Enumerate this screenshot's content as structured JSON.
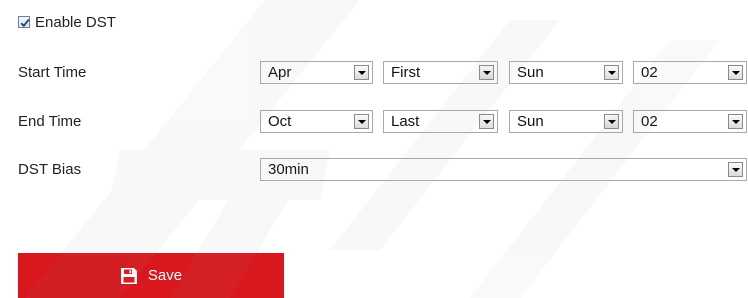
{
  "dst": {
    "enable_label": "Enable DST",
    "enable_checked": true
  },
  "start_time": {
    "label": "Start Time",
    "month": "Apr",
    "week": "First",
    "day": "Sun",
    "hour": "02"
  },
  "end_time": {
    "label": "End Time",
    "month": "Oct",
    "week": "Last",
    "day": "Sun",
    "hour": "02"
  },
  "dst_bias": {
    "label": "DST Bias",
    "value": "30min"
  },
  "actions": {
    "save_label": "Save",
    "save_color": "#d8171e"
  },
  "icons": {
    "save": "floppy-disk-icon",
    "checkbox": "checkmark-icon",
    "dropdown": "chevron-down-icon"
  }
}
